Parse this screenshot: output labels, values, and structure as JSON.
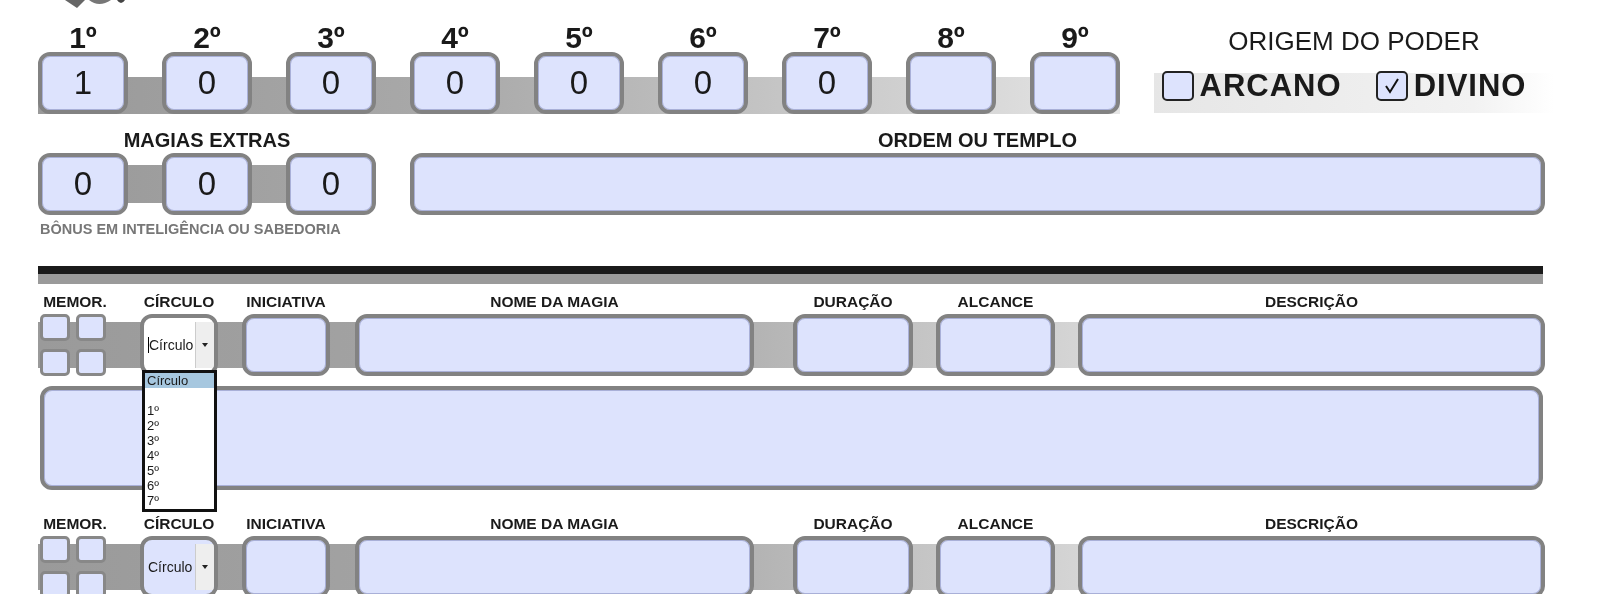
{
  "spell_levels": [
    {
      "label": "1º",
      "value": "1"
    },
    {
      "label": "2º",
      "value": "0"
    },
    {
      "label": "3º",
      "value": "0"
    },
    {
      "label": "4º",
      "value": "0"
    },
    {
      "label": "5º",
      "value": "0"
    },
    {
      "label": "6º",
      "value": "0"
    },
    {
      "label": "7º",
      "value": "0"
    },
    {
      "label": "8º"
    },
    {
      "label": "9º"
    }
  ],
  "power_origin": {
    "title": "ORIGEM DO PODER",
    "options": [
      {
        "label": "ARCANO",
        "checked": false
      },
      {
        "label": "DIVINO",
        "checked": true
      }
    ]
  },
  "extra_spells": {
    "title": "MAGIAS EXTRAS",
    "values": [
      "0",
      "0",
      "0"
    ],
    "note": "BÔNUS EM INTELIGÊNCIA OU SABEDORIA"
  },
  "order": {
    "label": "ORDEM OU TEMPLO"
  },
  "spells": [
    {
      "columns": [
        "MEMOR.",
        "CÍRCULO",
        "INICIATIVA",
        "NOME DA MAGIA",
        "DURAÇÃO",
        "ALCANCE",
        "DESCRIÇÃO"
      ],
      "memorized": [
        false,
        false,
        false,
        false
      ],
      "circle": {
        "value": "Círculo",
        "focused": true
      },
      "dropdown": {
        "options": [
          {
            "kind": "placeholder",
            "label": "Círculo",
            "selected": true
          },
          {
            "label": "1º",
            "selected": false
          },
          {
            "label": "2º",
            "selected": false
          },
          {
            "label": "3º",
            "selected": false
          },
          {
            "label": "4º",
            "selected": false
          },
          {
            "label": "5º",
            "selected": false
          },
          {
            "label": "6º",
            "selected": false
          },
          {
            "label": "7º",
            "selected": false
          }
        ]
      },
      "has_notes": true
    },
    {
      "columns": [
        "MEMOR.",
        "CÍRCULO",
        "INICIATIVA",
        "NOME DA MAGIA",
        "DURAÇÃO",
        "ALCANCE",
        "DESCRIÇÃO"
      ],
      "memorized": [
        false,
        false,
        false,
        false
      ],
      "circle": {
        "value": "Círculo",
        "focused": false
      },
      "has_notes": false
    }
  ]
}
